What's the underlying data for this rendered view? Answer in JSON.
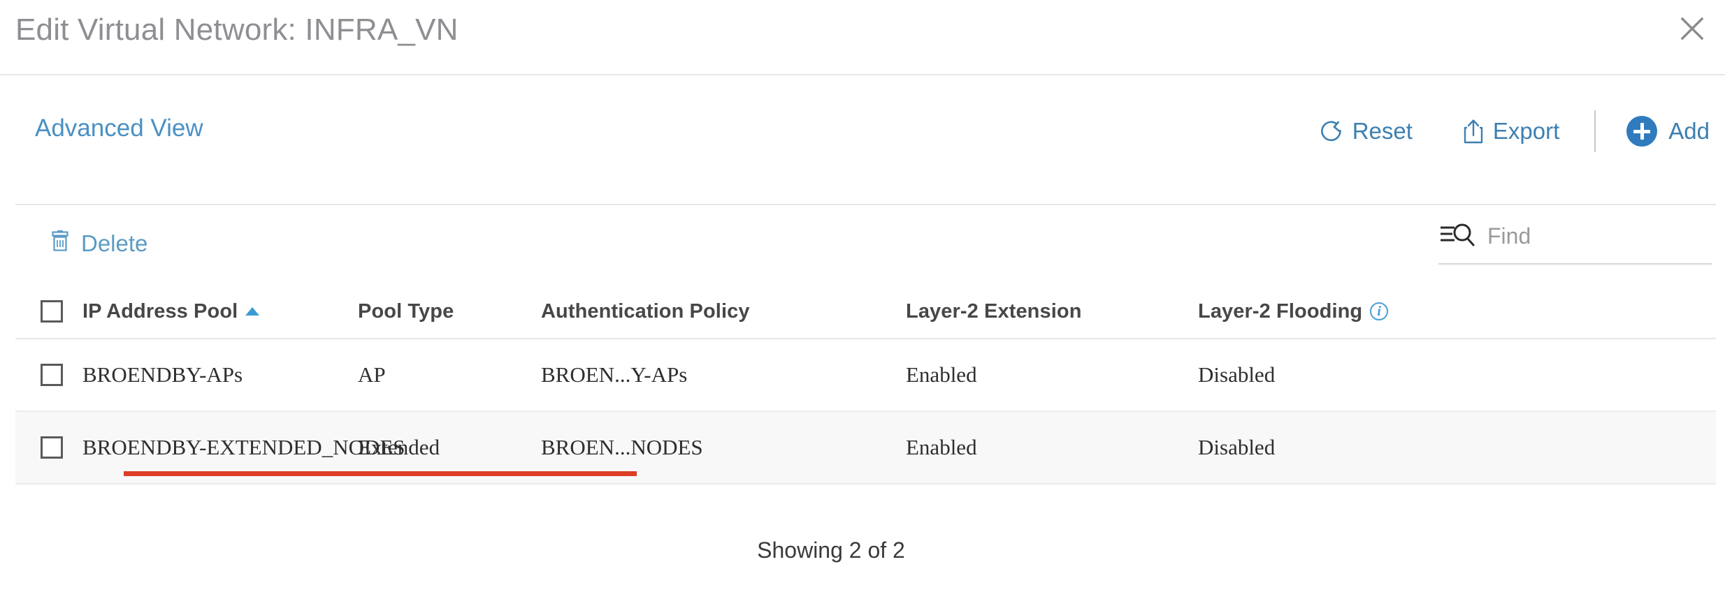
{
  "dialog": {
    "title": "Edit Virtual Network: INFRA_VN",
    "close_icon": "close-icon"
  },
  "toolbar": {
    "advanced_view_label": "Advanced View",
    "reset_label": "Reset",
    "reset_icon": "refresh-icon",
    "export_label": "Export",
    "export_icon": "upload-icon",
    "add_label": "Add",
    "add_icon": "plus-circle-icon"
  },
  "actions": {
    "delete_label": "Delete",
    "delete_icon": "trash-icon"
  },
  "search": {
    "placeholder": "Find",
    "value": "",
    "icon": "filter-search-icon"
  },
  "table": {
    "sort_column": "IP Address Pool",
    "sort_direction": "asc",
    "columns": [
      {
        "key": "ip_address_pool",
        "label": "IP Address Pool",
        "sorted": true
      },
      {
        "key": "pool_type",
        "label": "Pool Type",
        "sorted": false
      },
      {
        "key": "authentication_policy",
        "label": "Authentication Policy",
        "sorted": false
      },
      {
        "key": "layer2_extension",
        "label": "Layer-2 Extension",
        "sorted": false
      },
      {
        "key": "layer2_flooding",
        "label": "Layer-2 Flooding",
        "sorted": false,
        "info": true
      }
    ],
    "rows": [
      {
        "ip_address_pool": "BROENDBY-APs",
        "pool_type": "AP",
        "authentication_policy": "BROEN...Y-APs",
        "layer2_extension": "Enabled",
        "layer2_flooding": "Disabled",
        "selected": false
      },
      {
        "ip_address_pool": "BROENDBY-EXTENDED_NODES",
        "pool_type": "Extended",
        "authentication_policy": "BROEN...NODES",
        "layer2_extension": "Enabled",
        "layer2_flooding": "Disabled",
        "selected": false,
        "highlighted": true
      }
    ]
  },
  "footer": {
    "showing_text": "Showing 2 of 2"
  },
  "colors": {
    "link_blue": "#3c7fb1",
    "accent_blue": "#2f7bbd",
    "annotation_red": "#dc3e26",
    "title_gray": "#8e8e93",
    "row_alt_bg": "#f8f8f8"
  }
}
